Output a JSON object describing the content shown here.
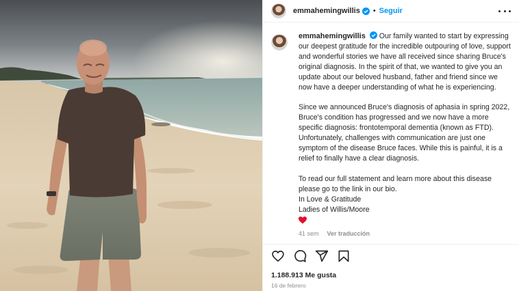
{
  "post": {
    "username": "emmahemingwillis",
    "follow_label": "Seguir",
    "header_separator": "•",
    "caption_paragraphs": [
      "Our family wanted to start by expressing our deepest gratitude for the incredible outpouring of love, support and wonderful stories we have all received since sharing Bruce's original diagnosis. In the spirit of that, we wanted to give you an update about our beloved husband, father and friend since we now have a deeper understanding of what he is experiencing.",
      "Since we announced Bruce's diagnosis of aphasia in spring 2022, Bruce's condition has progressed and we now have a more specific diagnosis: frontotemporal dementia (known as FTD). Unfortunately, challenges with communication are just one symptom of the disease Bruce faces. While this is painful, it is a relief to finally have a clear diagnosis.",
      "To read our full statement and learn more about this disease please go to the link in our bio.\nIn Love & Gratitude\nLadies of Willis/Moore"
    ],
    "emoji_icon": "red-heart-emoji",
    "time_ago": "41 sem",
    "translate_label": "Ver traducción",
    "likes": "1.188.913 Me gusta",
    "date": "16 de febrero"
  },
  "icons": [
    "verified-badge-icon",
    "more-options-icon",
    "heart-icon",
    "comment-icon",
    "share-icon",
    "bookmark-icon"
  ],
  "colors": {
    "link_blue": "#0095f6",
    "text": "#262626",
    "muted": "#8e8e8e",
    "heart_red": "#e0102f",
    "border": "#efefef"
  }
}
